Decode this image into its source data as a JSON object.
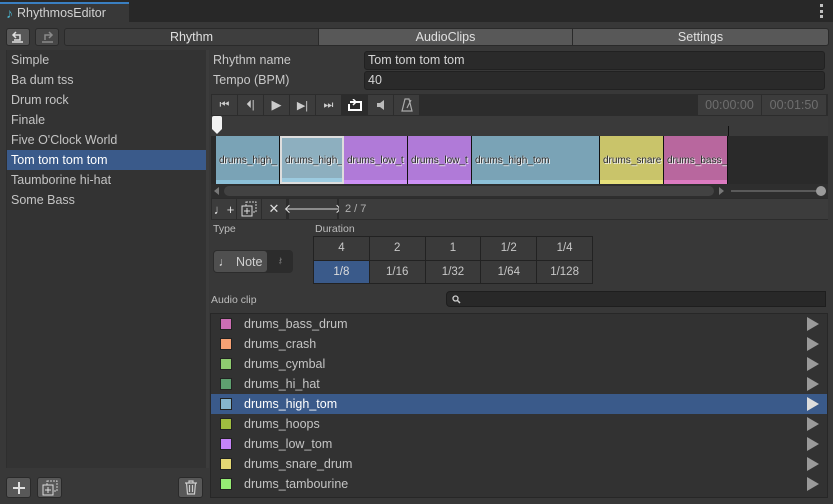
{
  "window": {
    "title": "RhythmosEditor",
    "menu_icon": "kebab-menu-icon"
  },
  "toolbar": {
    "undo_icon": "undo-icon",
    "redo_icon": "redo-icon"
  },
  "tabs": [
    {
      "label": "Rhythm",
      "active": true
    },
    {
      "label": "AudioClips",
      "active": false
    },
    {
      "label": "Settings",
      "active": false
    }
  ],
  "rhythms": {
    "selected_index": 5,
    "items": [
      "Simple",
      "Ba dum tss",
      "Drum rock",
      "Finale",
      "Five O'Clock World",
      "Tom tom tom tom",
      "Taumborine hi-hat",
      "Some Bass"
    ]
  },
  "list_buttons": {
    "add": "plus-icon",
    "duplicate": "duplicate-icon",
    "delete": "trash-icon"
  },
  "form": {
    "name_label": "Rhythm name",
    "name_value": "Tom tom tom tom",
    "tempo_label": "Tempo (BPM)",
    "tempo_value": "40"
  },
  "transport": {
    "buttons": [
      "skip-to-start",
      "previous",
      "play",
      "next",
      "skip-to-end",
      "loop",
      "mute",
      "metronome"
    ],
    "current_time": "00:00:00",
    "total_time": "00:01:50"
  },
  "timeline": {
    "clips": [
      {
        "label": "drums_high_",
        "color": "#7aa3b6",
        "stripe": "#8cc0d8",
        "selected": false
      },
      {
        "label": "drums_high_",
        "color": "#8dafbf",
        "stripe": "#9ccbe0",
        "selected": true
      },
      {
        "label": "drums_low_t",
        "color": "#b07ad8",
        "stripe": "#cc90f5",
        "selected": false
      },
      {
        "label": "drums_low_t",
        "color": "#b07ad8",
        "stripe": "#cc90f5",
        "selected": false
      },
      {
        "label": "drums_high_tom",
        "color": "#7aa3b6",
        "stripe": "#8cc0d8",
        "selected": false
      },
      {
        "label": "drums_snare",
        "color": "#c9c46a",
        "stripe": "#e6e07a",
        "selected": false
      },
      {
        "label": "drums_bass_",
        "color": "#b8679e",
        "stripe": "#dc7ac0",
        "selected": false
      }
    ],
    "clip_weights": [
      2,
      2,
      2,
      2,
      4,
      2,
      2
    ],
    "zoom_level": 0.95
  },
  "note_toolbar": {
    "buttons": [
      "add-note",
      "duplicate-note",
      "delete-note",
      "move-left",
      "move-right"
    ],
    "position": "2 / 7"
  },
  "note_editor": {
    "type_label": "Type",
    "type_note": "Note",
    "duration_label": "Duration",
    "durations": [
      "4",
      "2",
      "1",
      "1/2",
      "1/4",
      "1/8",
      "1/16",
      "1/32",
      "1/64",
      "1/128"
    ],
    "selected_duration": "1/8"
  },
  "audio_clip": {
    "label": "Audio clip",
    "search_placeholder": "",
    "selected_index": 4,
    "items": [
      {
        "name": "drums_bass_drum",
        "color": "#cc6eb4"
      },
      {
        "name": "drums_crash",
        "color": "#f7a274"
      },
      {
        "name": "drums_cymbal",
        "color": "#8fcc70"
      },
      {
        "name": "drums_hi_hat",
        "color": "#5ea070"
      },
      {
        "name": "drums_high_tom",
        "color": "#86b6ce"
      },
      {
        "name": "drums_hoops",
        "color": "#a0be40"
      },
      {
        "name": "drums_low_tom",
        "color": "#c684f8"
      },
      {
        "name": "drums_snare_drum",
        "color": "#e4d874"
      },
      {
        "name": "drums_tambourine",
        "color": "#96ec74"
      }
    ]
  }
}
